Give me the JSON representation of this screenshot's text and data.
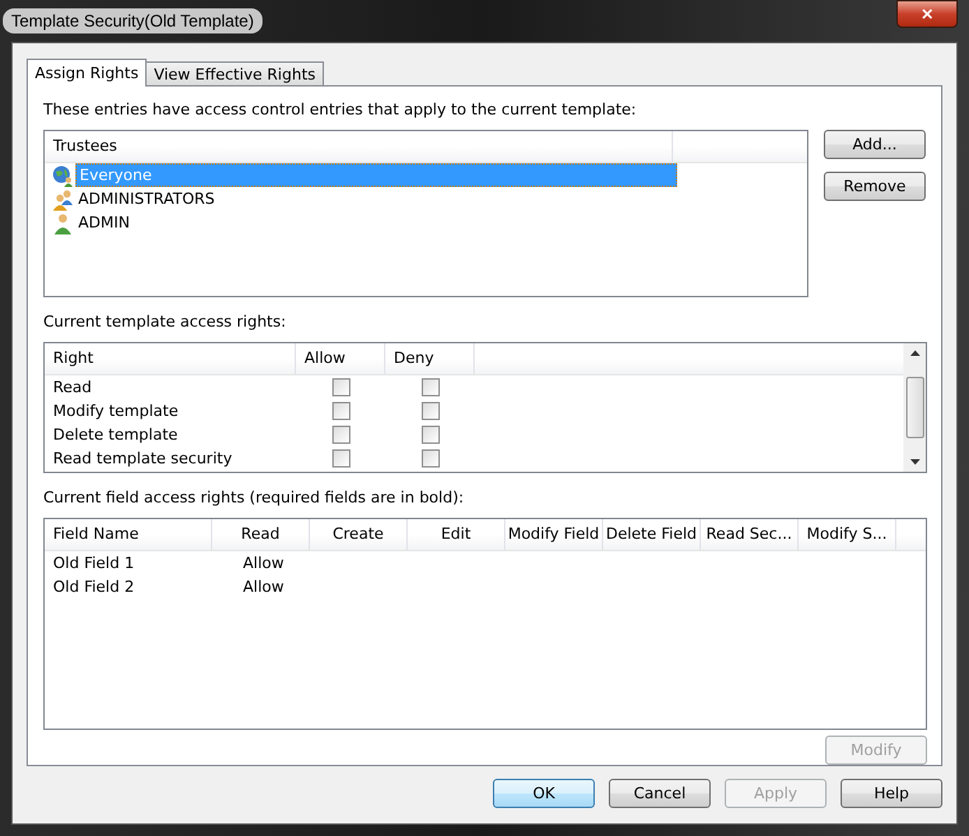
{
  "window": {
    "title": "Template Security(Old Template)",
    "close": "✕"
  },
  "tabs": [
    {
      "label": "Assign Rights",
      "selected": true
    },
    {
      "label": "View Effective Rights",
      "selected": false
    }
  ],
  "description": "These entries have access control entries that apply to the current template:",
  "trustees": {
    "column": "Trustees",
    "rows": [
      {
        "name": "Everyone",
        "kind": "globe",
        "selected": true
      },
      {
        "name": "ADMINISTRATORS",
        "kind": "group",
        "selected": false
      },
      {
        "name": "ADMIN",
        "kind": "user",
        "selected": false
      }
    ]
  },
  "trustee_buttons": [
    {
      "label": "Add...",
      "disabled": false
    },
    {
      "label": "Remove",
      "disabled": false
    }
  ],
  "rights_label": "Current template access rights:",
  "rights": {
    "columns": [
      "Right",
      "Allow",
      "Deny"
    ],
    "rows": [
      {
        "right": "Read",
        "allow": false,
        "deny": false
      },
      {
        "right": "Modify template",
        "allow": false,
        "deny": false
      },
      {
        "right": "Delete template",
        "allow": false,
        "deny": false
      },
      {
        "right": "Read template security",
        "allow": false,
        "deny": false
      }
    ]
  },
  "fields_label": "Current field access rights (required fields are in bold):",
  "fields": {
    "columns": [
      "Field Name",
      "Read",
      "Create",
      "Edit",
      "Modify Field",
      "Delete Field",
      "Read Sec...",
      "Modify S..."
    ],
    "rows": [
      [
        "Old Field 1",
        "Allow"
      ],
      [
        "Old Field 2",
        "Allow"
      ]
    ]
  },
  "modify_button": {
    "label": "Modify",
    "disabled": true
  },
  "footer_buttons": [
    {
      "label": "OK",
      "disabled": false,
      "default": true
    },
    {
      "label": "Cancel",
      "disabled": false,
      "default": false
    },
    {
      "label": "Apply",
      "disabled": true,
      "default": false
    },
    {
      "label": "Help",
      "disabled": false,
      "default": false
    }
  ]
}
